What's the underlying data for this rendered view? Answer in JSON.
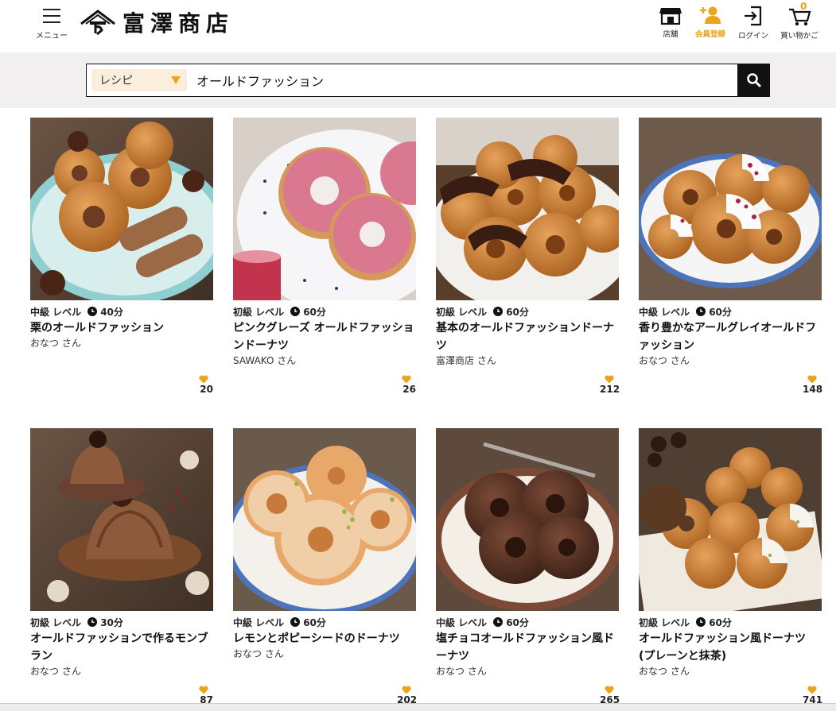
{
  "header": {
    "menu_label": "メニュー",
    "logo_text": "富澤商店",
    "nav": [
      {
        "label": "店舗",
        "icon": "shop-icon"
      },
      {
        "label": "会員登録",
        "icon": "add-user-icon"
      },
      {
        "label": "ログイン",
        "icon": "login-icon"
      },
      {
        "label": "買い物かご",
        "icon": "cart-icon",
        "count": "0"
      }
    ]
  },
  "search": {
    "category": "レシピ",
    "query": "オールドファッション"
  },
  "colors": {
    "accent": "#e9a51b",
    "band": "#f1efef",
    "dark": "#111111"
  },
  "recipes": [
    {
      "level": "中級 レベル",
      "time": "40分",
      "title": "栗のオールドファッション",
      "author": "おなつ さん",
      "likes": "20"
    },
    {
      "level": "初級 レベル",
      "time": "60分",
      "title": "ピンクグレーズ オールドファッションドーナツ",
      "author": "SAWAKO さん",
      "likes": "26"
    },
    {
      "level": "初級 レベル",
      "time": "60分",
      "title": "基本のオールドファッションドーナツ",
      "author": "富澤商店 さん",
      "likes": "212"
    },
    {
      "level": "中級 レベル",
      "time": "60分",
      "title": "香り豊かなアールグレイオールドファッション",
      "author": "おなつ さん",
      "likes": "148"
    },
    {
      "level": "初級 レベル",
      "time": "30分",
      "title": "オールドファッションで作るモンブラン",
      "author": "おなつ さん",
      "likes": "87"
    },
    {
      "level": "中級 レベル",
      "time": "60分",
      "title": "レモンとポピーシードのドーナツ",
      "author": "おなつ さん",
      "likes": "202"
    },
    {
      "level": "中級 レベル",
      "time": "60分",
      "title": "塩チョコオールドファッション風ドーナツ",
      "author": "おなつ さん",
      "likes": "265"
    },
    {
      "level": "初級 レベル",
      "time": "60分",
      "title": "オールドファッション風ドーナツ(プレーンと抹茶)",
      "author": "おなつ さん",
      "likes": "741"
    }
  ]
}
